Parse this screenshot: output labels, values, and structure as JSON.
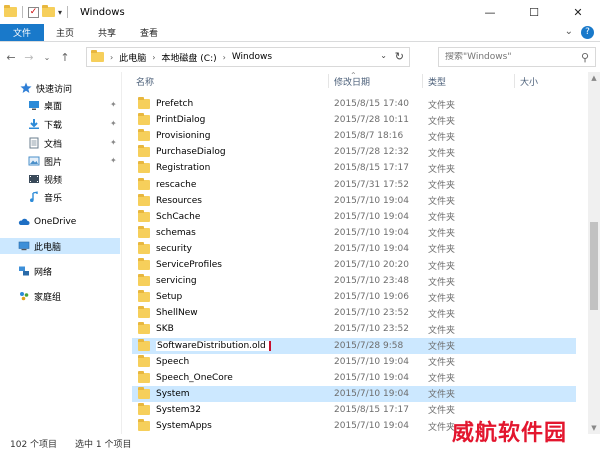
{
  "window": {
    "title": "Windows"
  },
  "ribbon": {
    "tabs": [
      "文件",
      "主页",
      "共享",
      "查看"
    ]
  },
  "address": {
    "crumbs": [
      "此电脑",
      "本地磁盘 (C:)",
      "Windows"
    ]
  },
  "search": {
    "placeholder": "搜索\"Windows\""
  },
  "sidebar": {
    "items": [
      {
        "label": "快速访问",
        "icon": "star-icon"
      },
      {
        "label": "桌面",
        "icon": "desktop-icon"
      },
      {
        "label": "下载",
        "icon": "download-icon"
      },
      {
        "label": "文档",
        "icon": "document-icon"
      },
      {
        "label": "图片",
        "icon": "pictures-icon"
      },
      {
        "label": "视频",
        "icon": "video-icon"
      },
      {
        "label": "音乐",
        "icon": "music-icon"
      },
      {
        "label": "OneDrive",
        "icon": "cloud-icon"
      },
      {
        "label": "此电脑",
        "icon": "computer-icon"
      },
      {
        "label": "网络",
        "icon": "network-icon"
      },
      {
        "label": "家庭组",
        "icon": "homegroup-icon"
      }
    ]
  },
  "columns": {
    "name": "名称",
    "date": "修改日期",
    "type": "类型",
    "size": "大小"
  },
  "files": [
    {
      "name": "Prefetch",
      "date": "2015/8/15 17:40",
      "type": "文件夹"
    },
    {
      "name": "PrintDialog",
      "date": "2015/7/28 10:11",
      "type": "文件夹"
    },
    {
      "name": "Provisioning",
      "date": "2015/8/7 18:16",
      "type": "文件夹"
    },
    {
      "name": "PurchaseDialog",
      "date": "2015/7/28 12:32",
      "type": "文件夹"
    },
    {
      "name": "Registration",
      "date": "2015/8/15 17:17",
      "type": "文件夹"
    },
    {
      "name": "rescache",
      "date": "2015/7/31 17:52",
      "type": "文件夹"
    },
    {
      "name": "Resources",
      "date": "2015/7/10 19:04",
      "type": "文件夹"
    },
    {
      "name": "SchCache",
      "date": "2015/7/10 19:04",
      "type": "文件夹"
    },
    {
      "name": "schemas",
      "date": "2015/7/10 19:04",
      "type": "文件夹"
    },
    {
      "name": "security",
      "date": "2015/7/10 19:04",
      "type": "文件夹"
    },
    {
      "name": "ServiceProfiles",
      "date": "2015/7/10 20:20",
      "type": "文件夹"
    },
    {
      "name": "servicing",
      "date": "2015/7/10 23:48",
      "type": "文件夹"
    },
    {
      "name": "Setup",
      "date": "2015/7/10 19:06",
      "type": "文件夹"
    },
    {
      "name": "ShellNew",
      "date": "2015/7/10 23:52",
      "type": "文件夹"
    },
    {
      "name": "SKB",
      "date": "2015/7/10 23:52",
      "type": "文件夹"
    },
    {
      "name": "SoftwareDistribution.old",
      "date": "2015/7/28 9:58",
      "type": "文件夹"
    },
    {
      "name": "Speech",
      "date": "2015/7/10 19:04",
      "type": "文件夹"
    },
    {
      "name": "Speech_OneCore",
      "date": "2015/7/10 19:04",
      "type": "文件夹"
    },
    {
      "name": "System",
      "date": "2015/7/10 19:04",
      "type": "文件夹"
    },
    {
      "name": "System32",
      "date": "2015/8/15 17:17",
      "type": "文件夹"
    },
    {
      "name": "SystemApps",
      "date": "2015/7/10 19:04",
      "type": "文件夹"
    }
  ],
  "status": {
    "count": "102 个项目",
    "selected": "选中 1 个项目"
  },
  "watermark": "威航软件园",
  "colors": {
    "accent": "#1979ca",
    "selection": "#cce8ff",
    "rename_border": "#c8102e",
    "folder": "#f6cf5b"
  }
}
